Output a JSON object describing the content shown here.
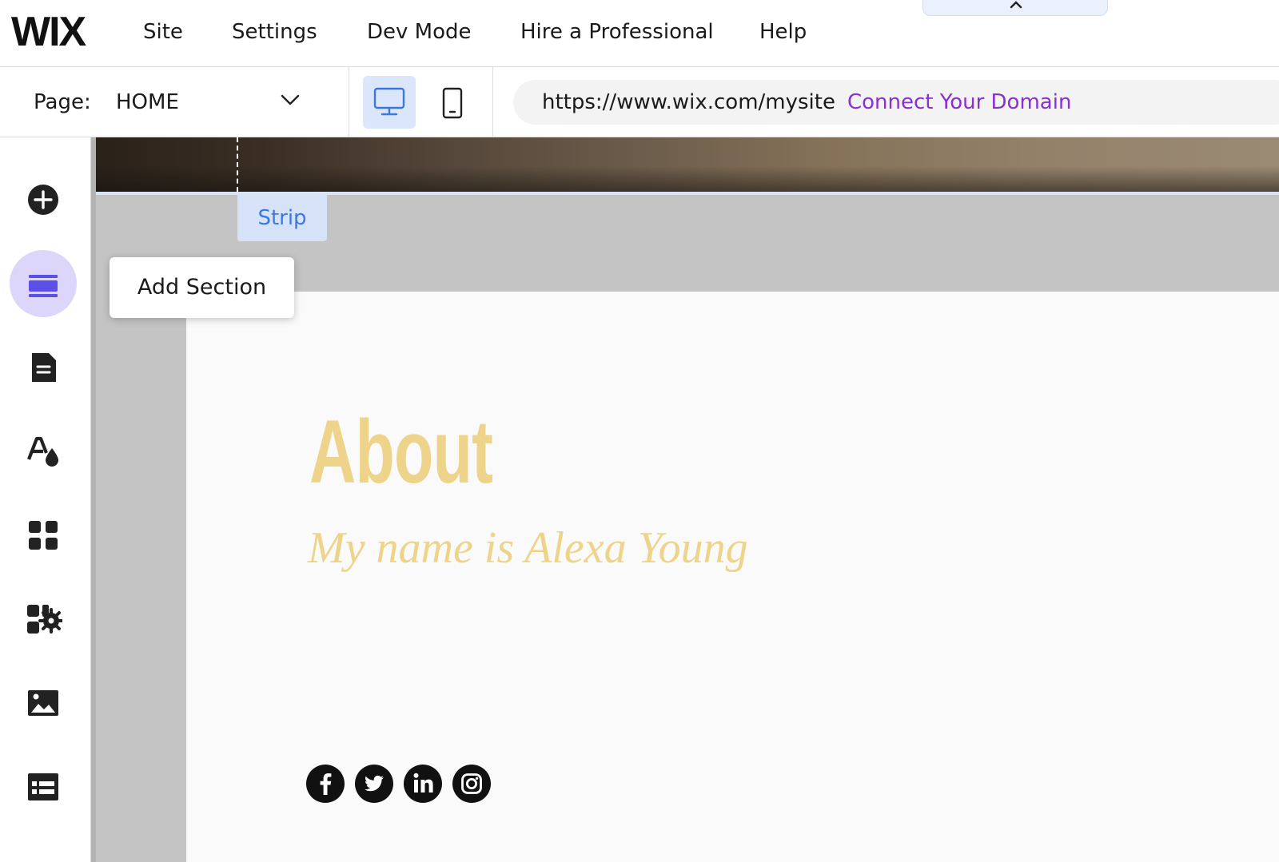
{
  "topbar": {
    "logo": "WIX",
    "menu": [
      "Site",
      "Settings",
      "Dev Mode",
      "Hire a Professional",
      "Help"
    ]
  },
  "toolbar": {
    "page_label": "Page:",
    "page_value": "HOME",
    "url": "https://www.wix.com/mysite",
    "connect_domain": "Connect Your Domain"
  },
  "sidebar": {
    "items": [
      "add-elements",
      "sections",
      "pages",
      "site-design",
      "app-market",
      "business-apps",
      "media",
      "cms"
    ],
    "active": "sections",
    "tooltip": "Add Section"
  },
  "canvas": {
    "strip_label": "Strip",
    "about_title": "About",
    "about_subtitle": "My name is Alexa Young",
    "social_icons": [
      "facebook-icon",
      "twitter-icon",
      "linkedin-icon",
      "instagram-icon"
    ]
  },
  "colors": {
    "accent_link": "#8a2fd3",
    "active_sidebar": "#dcd6fb",
    "device_active": "#dbe6fb",
    "strip_tag_text": "#3b79e0",
    "about_text": "#eed38a",
    "canvas_gray": "#c4c4c4"
  }
}
